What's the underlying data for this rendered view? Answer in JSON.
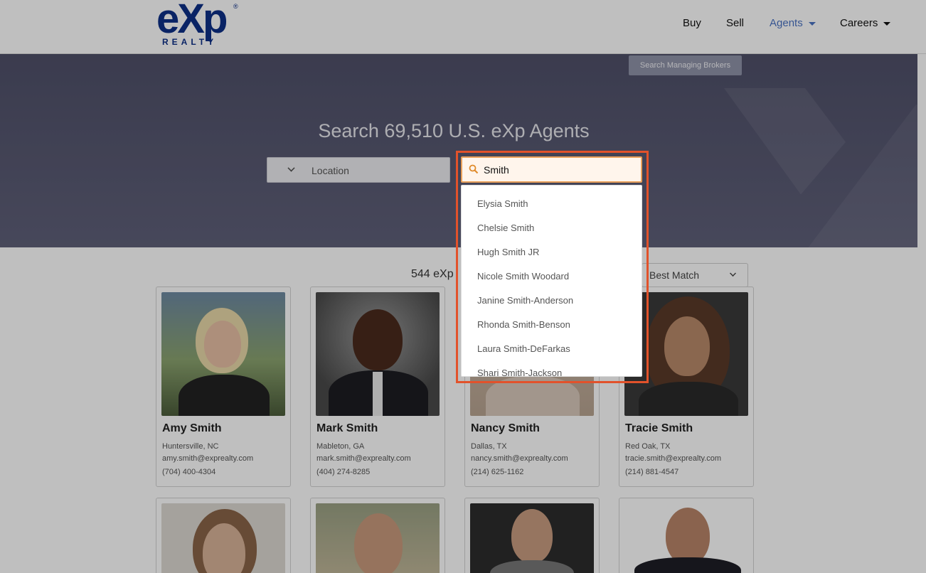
{
  "header": {
    "logo_word": "eXp",
    "logo_sub": "REALTY",
    "logo_reg": "®",
    "nav": [
      {
        "label": "Buy"
      },
      {
        "label": "Sell"
      },
      {
        "label": "Agents"
      },
      {
        "label": "Careers"
      }
    ]
  },
  "hero": {
    "managing_brokers_button": "Search Managing Brokers",
    "title": "Search 69,510 U.S. eXp Agents",
    "location_label": "Location"
  },
  "search": {
    "value": "Smith",
    "suggestions": [
      "Elysia Smith",
      "Chelsie Smith",
      "Hugh Smith JR",
      "Nicole Smith Woodard",
      "Janine Smith-Anderson",
      "Rhonda Smith-Benson",
      "Laura Smith-DeFarkas",
      "Shari Smith-Jackson"
    ]
  },
  "results": {
    "count_text": "544 eXp",
    "sort_label": "Best Match"
  },
  "agents": [
    {
      "name": "Amy Smith",
      "city": "Huntersville, NC",
      "email": "amy.smith@exprealty.com",
      "phone": "(704) 400-4304"
    },
    {
      "name": "Mark Smith",
      "city": "Mableton, GA",
      "email": "mark.smith@exprealty.com",
      "phone": "(404) 274-8285"
    },
    {
      "name": "Nancy Smith",
      "city": "Dallas, TX",
      "email": "nancy.smith@exprealty.com",
      "phone": "(214) 625-1162"
    },
    {
      "name": "Tracie Smith",
      "city": "Red Oak, TX",
      "email": "tracie.smith@exprealty.com",
      "phone": "(214) 881-4547"
    }
  ],
  "colors": {
    "brand": "#0c2f87",
    "active_nav": "#4a72c2",
    "highlight": "#e2522b"
  }
}
